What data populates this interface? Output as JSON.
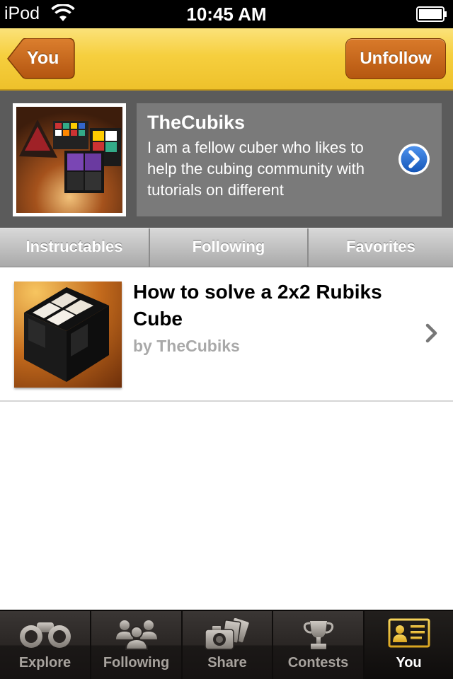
{
  "status_bar": {
    "carrier": "iPod",
    "time": "10:45 AM"
  },
  "nav": {
    "back_label": "You",
    "action_label": "Unfollow"
  },
  "profile": {
    "name": "TheCubiks",
    "bio": "I am a fellow cuber who likes to help the cubing community with tutorials on different"
  },
  "tabs": [
    {
      "label": "Instructables"
    },
    {
      "label": "Following"
    },
    {
      "label": "Favorites"
    }
  ],
  "items": [
    {
      "title": "How to solve a 2x2 Rubiks Cube",
      "author": "by TheCubiks"
    }
  ],
  "tabbar": [
    {
      "label": "Explore",
      "icon": "binoculars-icon"
    },
    {
      "label": "Following",
      "icon": "people-icon"
    },
    {
      "label": "Share",
      "icon": "camera-photos-icon"
    },
    {
      "label": "Contests",
      "icon": "trophy-icon"
    },
    {
      "label": "You",
      "icon": "id-card-icon",
      "active": true
    }
  ],
  "colors": {
    "nav_yellow": "#f6cf3e",
    "button_orange": "#c8661c",
    "profile_bg": "#5b5b5b",
    "disclosure_blue": "#1f6fd1"
  }
}
